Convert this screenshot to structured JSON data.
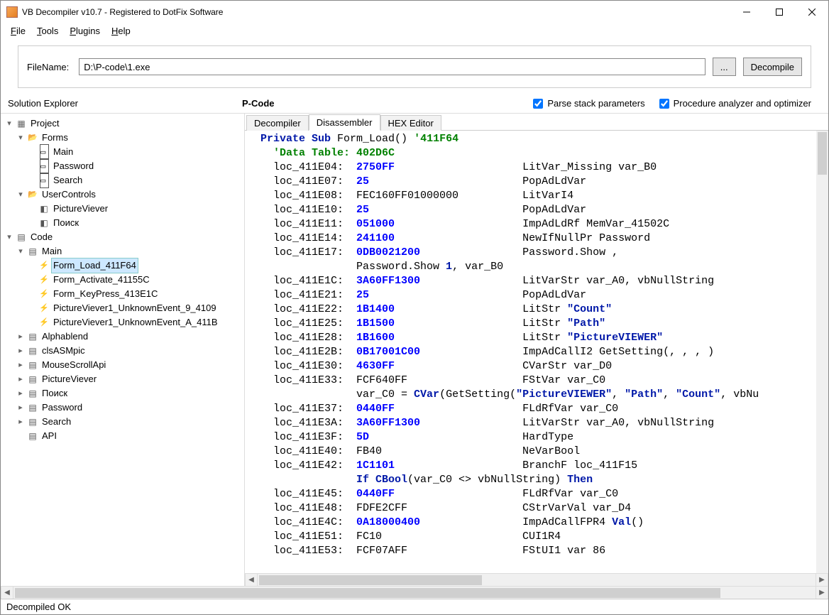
{
  "window": {
    "title": "VB Decompiler v10.7 - Registered to DotFix Software"
  },
  "menu": {
    "file": "File",
    "tools": "Tools",
    "plugins": "Plugins",
    "help": "Help"
  },
  "toolbar": {
    "filename_label": "FileName:",
    "filename_value": "D:\\P-code\\1.exe",
    "browse": "...",
    "decompile": "Decompile"
  },
  "headers": {
    "solution_explorer": "Solution Explorer",
    "pcode": "P-Code",
    "parse_stack": "Parse stack parameters",
    "proc_analyzer": "Procedure analyzer and optimizer"
  },
  "tree": {
    "project": "Project",
    "forms": "Forms",
    "forms_items": [
      "Main",
      "Password",
      "Search"
    ],
    "usercontrols": "UserControls",
    "uc_items": [
      "PictureViever",
      "Поиск"
    ],
    "code": "Code",
    "main": "Main",
    "main_events": [
      "Form_Load_411F64",
      "Form_Activate_41155C",
      "Form_KeyPress_413E1C",
      "PictureViever1_UnknownEvent_9_4109",
      "PictureViever1_UnknownEvent_A_411B"
    ],
    "modules": [
      "Alphablend",
      "clsASMpic",
      "MouseScrollApi",
      "PictureViever",
      "Поиск",
      "Password",
      "Search",
      "API"
    ]
  },
  "tabs": {
    "decompiler": "Decompiler",
    "disassembler": "Disassembler",
    "hex": "HEX Editor"
  },
  "status": "Decompiled OK",
  "code": {
    "l1a": "Private Sub",
    "l1b": " Form_Load() ",
    "l1c": "'411F64",
    "l2": "'Data Table: 402D6C",
    "r": [
      {
        "a": "loc_411E04:",
        "o": "2750FF",
        "c": "LitVar_Missing var_B0"
      },
      {
        "a": "loc_411E07:",
        "o": "25",
        "c": "PopAdLdVar"
      },
      {
        "a": "loc_411E08:",
        "o": "",
        "plain": "FEC160FF01000000",
        "c": "LitVarI4"
      },
      {
        "a": "loc_411E10:",
        "o": "25",
        "c": "PopAdLdVar"
      },
      {
        "a": "loc_411E11:",
        "o": "051000",
        "c": "ImpAdLdRf MemVar_41502C"
      },
      {
        "a": "loc_411E14:",
        "o": "241100",
        "c": "NewIfNullPr Password"
      },
      {
        "a": "loc_411E17:",
        "o": "0DB0021200",
        "c": "Password.Show ,"
      }
    ],
    "cont1a": "Password.Show ",
    "cont1b": "1",
    "cont1c": ", var_B0",
    "r2": [
      {
        "a": "loc_411E1C:",
        "o": "3A60FF1300",
        "c": "LitVarStr var_A0, vbNullString"
      },
      {
        "a": "loc_411E21:",
        "o": "25",
        "c": "PopAdLdVar"
      }
    ],
    "r3a": "loc_411E22:",
    "r3o": "1B1400",
    "r3c1": "LitStr ",
    "r3c2": "\"Count\"",
    "r4a": "loc_411E25:",
    "r4o": "1B1500",
    "r4c1": "LitStr ",
    "r4c2": "\"Path\"",
    "r5a": "loc_411E28:",
    "r5o": "1B1600",
    "r5c1": "LitStr ",
    "r5c2": "\"PictureVIEWER\"",
    "r6": [
      {
        "a": "loc_411E2B:",
        "o": "0B17001C00",
        "c": "ImpAdCallI2 GetSetting(, , , )"
      },
      {
        "a": "loc_411E30:",
        "o": "4630FF",
        "c": "CVarStr var_D0"
      }
    ],
    "r7a": "loc_411E33:",
    "r7p": "FCF640FF",
    "r7c": "FStVar var_C0",
    "cvline_a": "var_C0 = ",
    "cvline_b": "CVar",
    "cvline_c": "(GetSetting(",
    "cvline_d": "\"PictureVIEWER\"",
    "cvline_e": ", ",
    "cvline_f": "\"Path\"",
    "cvline_g": ", ",
    "cvline_h": "\"Count\"",
    "cvline_i": ", vbNu",
    "r8": [
      {
        "a": "loc_411E37:",
        "o": "0440FF",
        "c": "FLdRfVar var_C0"
      },
      {
        "a": "loc_411E3A:",
        "o": "3A60FF1300",
        "c": "LitVarStr var_A0, vbNullString"
      },
      {
        "a": "loc_411E3F:",
        "o": "5D",
        "c": "HardType"
      }
    ],
    "r9a": "loc_411E40:",
    "r9p": "FB40",
    "r9c": "NeVarBool",
    "r10": [
      {
        "a": "loc_411E42:",
        "o": "1C1101",
        "c": "BranchF loc_411F15"
      }
    ],
    "if_a": "If CBool",
    "if_b": "(var_C0 <> vbNullString) ",
    "if_c": "Then",
    "r11": [
      {
        "a": "loc_411E45:",
        "o": "0440FF",
        "c": "FLdRfVar var_C0"
      }
    ],
    "r12a": "loc_411E48:",
    "r12p": "FDFE2CFF",
    "r12c": "CStrVarVal var_D4",
    "r13a": "loc_411E4C:",
    "r13o": "0A18000400",
    "r13c1": "ImpAdCallFPR4 ",
    "r13c2": "Val",
    "r13c3": "()",
    "r14a": "loc_411E51:",
    "r14p": "FC10",
    "r14c": "CUI1R4",
    "r15a": "loc_411E53:",
    "r15p": "FCF07AFF",
    "r15c": "FStUI1 var 86"
  }
}
